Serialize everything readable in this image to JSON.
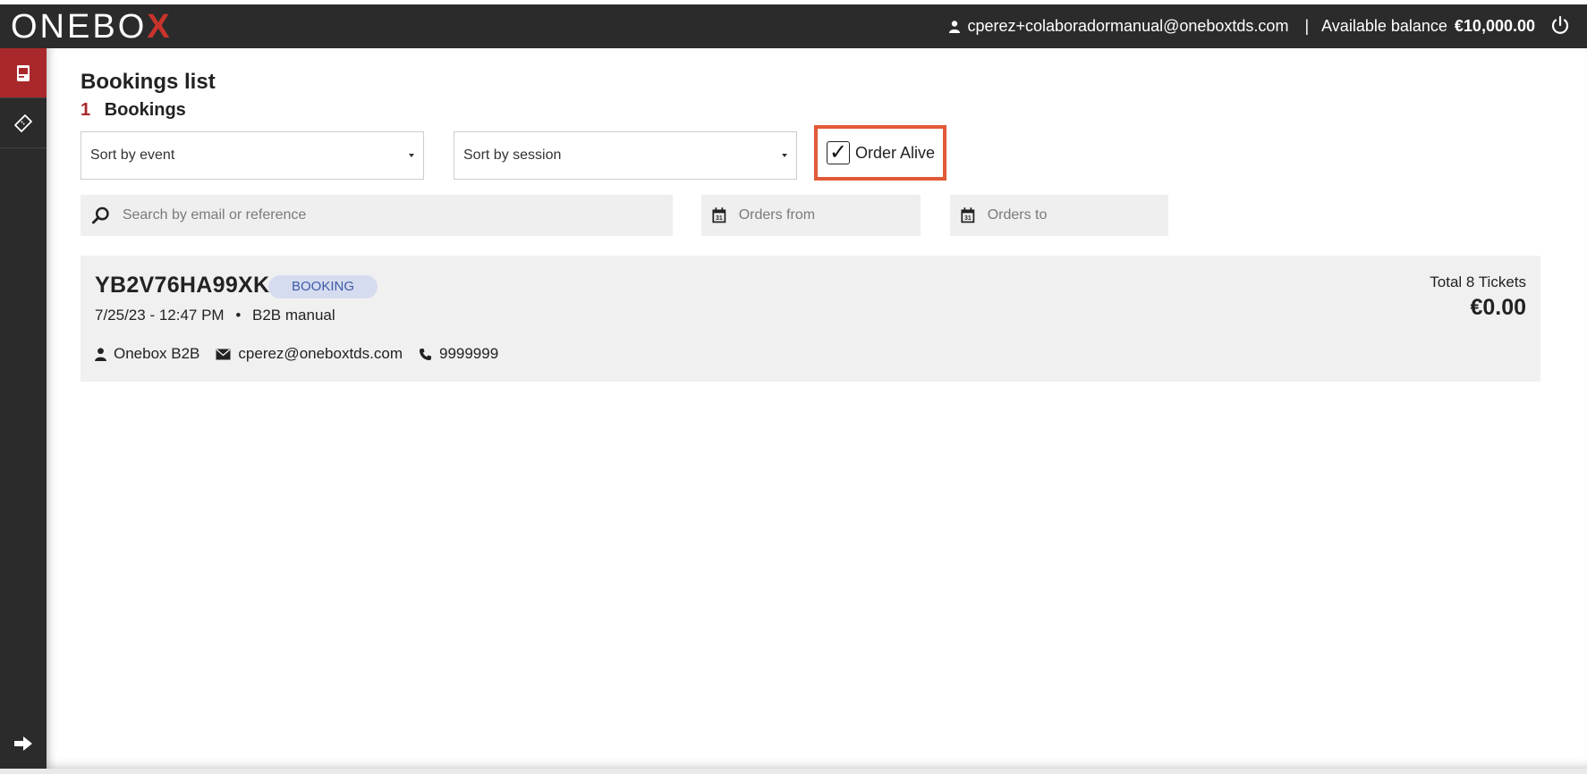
{
  "header": {
    "logo_text_main": "ONEBO",
    "logo_text_x": "X",
    "user_email": "cperez+colaboradormanual@oneboxtds.com",
    "separator": "|",
    "balance_label": "Available balance",
    "balance_value": "€10,000.00"
  },
  "sidebar": {
    "items": [
      {
        "icon": "bookings-icon",
        "active": true
      },
      {
        "icon": "ticket-icon",
        "active": false
      }
    ],
    "bottom_icon": "arrow-right-icon"
  },
  "page": {
    "title": "Bookings list",
    "count": "1",
    "count_label": "Bookings"
  },
  "filters": {
    "event_select": "Sort by event",
    "session_select": "Sort by session",
    "order_alive_label": "Order Alive",
    "order_alive_checked": true,
    "search_placeholder": "Search by email or reference",
    "from_placeholder": "Orders from",
    "to_placeholder": "Orders to",
    "highlight_color": "#e15a38"
  },
  "bookings": [
    {
      "reference": "YB2V76HA99XK",
      "status": "BOOKING",
      "datetime": "7/25/23 - 12:47 PM",
      "dot": "•",
      "channel": "B2B manual",
      "client": "Onebox B2B",
      "email": "cperez@oneboxtds.com",
      "phone": "9999999",
      "tickets": "Total 8 Tickets",
      "amount": "€0.00"
    }
  ],
  "colors": {
    "header_bg": "#2b2b2b",
    "accent": "#a8282b",
    "badge_bg": "#d6dcef",
    "badge_text": "#3d5aa8"
  }
}
